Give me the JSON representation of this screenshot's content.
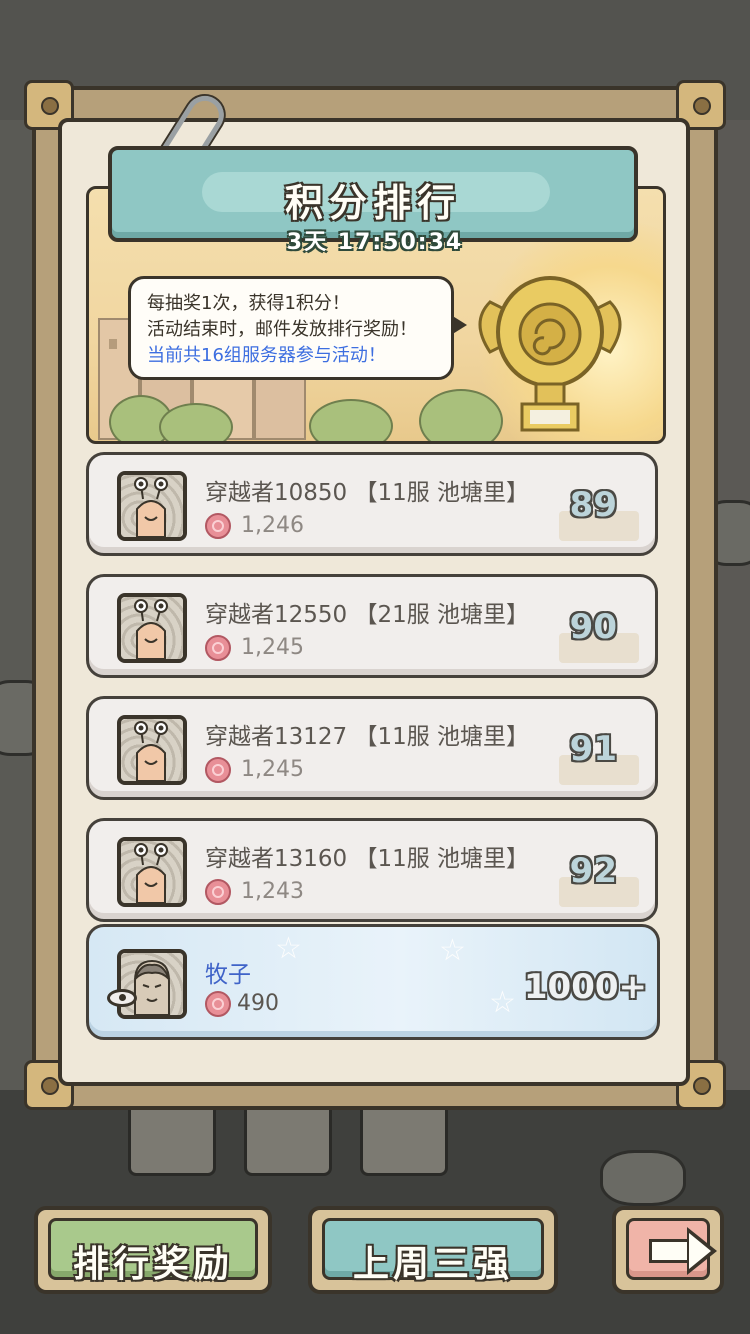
{
  "title": "积分排行",
  "countdown": "3天 17:50:34",
  "info": {
    "line1": "每抽奖1次，获得1积分！",
    "line2": "活动结束时，邮件发放排行奖励！",
    "line3": "当前共16组服务器参与活动！"
  },
  "rows": [
    {
      "name": "穿越者10850",
      "server": "【11服 池塘里】",
      "score": "1,246",
      "rank": "89"
    },
    {
      "name": "穿越者12550",
      "server": "【21服 池塘里】",
      "score": "1,245",
      "rank": "90"
    },
    {
      "name": "穿越者13127",
      "server": "【11服 池塘里】",
      "score": "1,245",
      "rank": "91"
    },
    {
      "name": "穿越者13160",
      "server": "【11服 池塘里】",
      "score": "1,243",
      "rank": "92"
    }
  ],
  "me": {
    "name": "牧子",
    "score": "490",
    "rank": "1000+"
  },
  "buttons": {
    "rank_rewards": "排行奖励",
    "last_week_top3": "上周三强"
  },
  "colors": {
    "title_board": "#8fc7c4",
    "rank_rewards_btn": "#a9c98c",
    "last_week_btn": "#8fc7c4",
    "next_btn": "#f0b4a8",
    "info_highlight": "#3d6ee0"
  },
  "icons": {
    "score": "snail-shell-icon",
    "next": "arrow-right-icon",
    "player_view": "eye-icon"
  }
}
